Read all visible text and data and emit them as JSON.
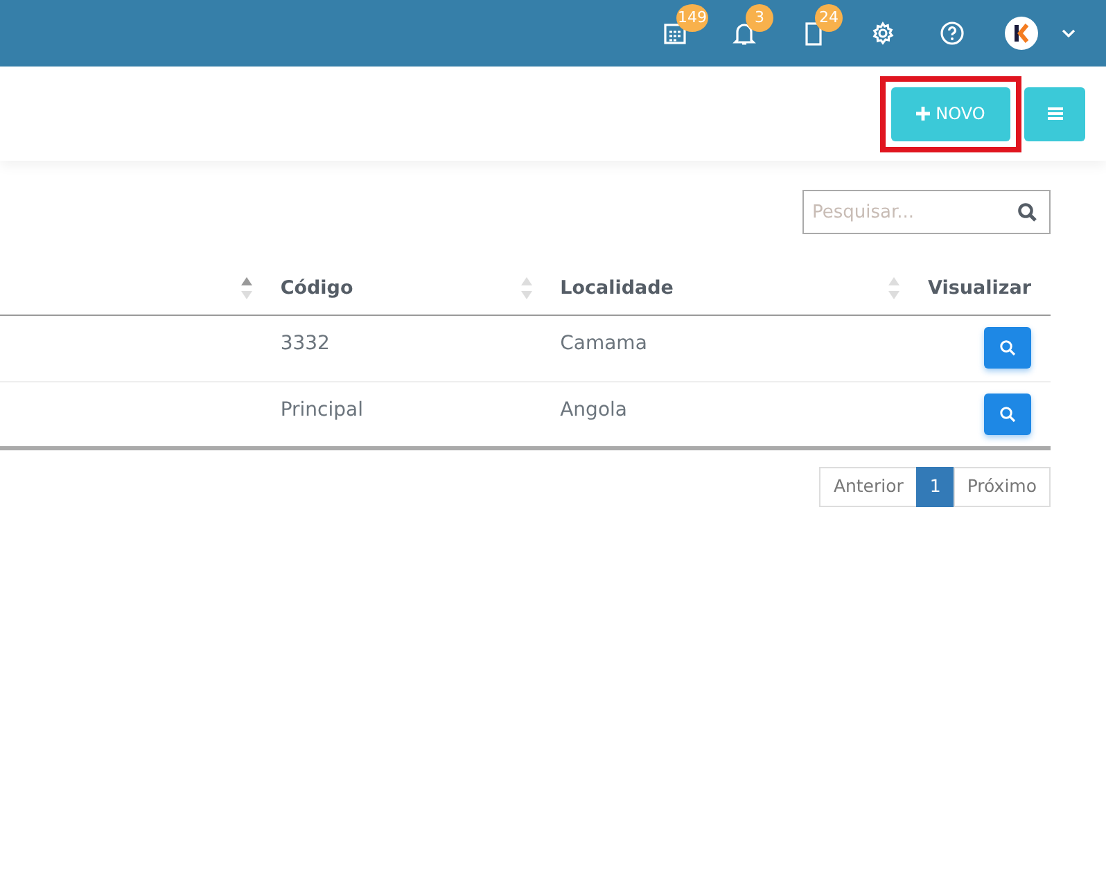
{
  "topbar": {
    "icons": [
      {
        "kind": "calendar",
        "badge": "149"
      },
      {
        "kind": "bell",
        "badge": "3"
      },
      {
        "kind": "document",
        "badge": "24"
      },
      {
        "kind": "settings"
      },
      {
        "kind": "help"
      },
      {
        "kind": "avatar"
      }
    ]
  },
  "actions": {
    "new_button": {
      "label": "NOVO",
      "highlighted": true
    },
    "menu_button_shown": true
  },
  "search": {
    "placeholder": "Pesquisar..."
  },
  "table": {
    "columns": [
      {
        "sorted_ascending": true
      },
      {
        "label": "Código",
        "sorted_ascending": false
      },
      {
        "label": "Localidade",
        "sorted_ascending": false
      },
      {
        "label": "Visualizar"
      }
    ],
    "rows": [
      {
        "cells": [
          null,
          "3332",
          "Camama"
        ]
      },
      {
        "cells": [
          null,
          "Principal",
          "Angola"
        ]
      }
    ]
  },
  "pagination": [
    {
      "label": "Anterior",
      "selected": false
    },
    {
      "label": "1",
      "selected": true
    },
    {
      "label": "Próximo",
      "selected": false
    }
  ]
}
